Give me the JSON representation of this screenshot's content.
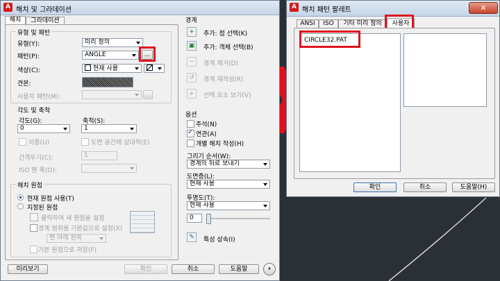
{
  "colors": {
    "highlight": "#e0121f",
    "canvas": "#2b3036",
    "dialog": "#f0f0f0",
    "accent": "#1b3b7a"
  },
  "left": {
    "title": "해치 및 그라데이션",
    "tabs": [
      "해치",
      "그라데이션"
    ],
    "type_pattern": {
      "group": "유형 및 패턴",
      "type_label": "유형(Y):",
      "type_value": "미리 정의",
      "pattern_label": "패턴(P):",
      "pattern_value": "ANGLE",
      "browse_label": "...",
      "color_label": "색상(C):",
      "color_value": "현재 사용",
      "color_icon": "no-fill-icon",
      "swatch_label": "견본:",
      "custom_label": "사용자 패턴(M):",
      "custom_browse": "..."
    },
    "angle_scale": {
      "group": "각도 및 축척",
      "angle_label": "각도(G):",
      "angle_value": "0",
      "scale_label": "축척(S):",
      "scale_value": "1",
      "double_label": "이중(U)",
      "paper_label": "도면 공간에 상대적(E)",
      "spacing_label": "간격두기(C):",
      "spacing_value": "1",
      "iso_label": "ISO 펜 폭(O):"
    },
    "origin": {
      "group": "해치 원점",
      "current_label": "현재 원점 사용(T)",
      "specified_label": "지정된 원점",
      "click_label": "클릭하여 새 원점을 설정",
      "default_extents_label": "경계 범위를 기본값으로 설정(X)",
      "corner_value": "맨 아래 왼쪽",
      "store_label": "기본 원점으로 저장(F)"
    },
    "boundaries": {
      "group": "경계",
      "items": [
        {
          "label": "추가: 점 선택(K)",
          "icon": "pick-points-icon",
          "enabled": true
        },
        {
          "label": "추가: 객체 선택(B)",
          "icon": "select-objects-icon",
          "enabled": true
        },
        {
          "label": "경계 제거(D)",
          "icon": "remove-boundaries-icon",
          "enabled": false
        },
        {
          "label": "경계 재작성(R)",
          "icon": "recreate-boundary-icon",
          "enabled": false
        },
        {
          "label": "선택 요소 보기(V)",
          "icon": "view-selections-icon",
          "enabled": false
        }
      ]
    },
    "options": {
      "group": "옵션",
      "annotative_label": "주석(N)",
      "associative_label": "연관(A)",
      "separate_label": "개별 해치 작성(H)",
      "draw_order_label": "그리기 순서(W):",
      "draw_order_value": "경계의 뒤로 보내기",
      "layer_label": "도면층(L):",
      "layer_value": "현재 사용",
      "transparency_label": "투명도(T):",
      "transparency_value": "현재 사용",
      "slider_value": "0"
    },
    "inherit_label": "특성 상속(I)",
    "footer": {
      "preview": "미리보기",
      "ok": "확인",
      "cancel": "취소",
      "help": "도움말",
      "more": "›"
    }
  },
  "right": {
    "title": "해치 패턴 팔레트",
    "tabs": [
      "ANSI",
      "ISO",
      "기타 미리 정의",
      "사용자"
    ],
    "list_items": [
      "CIRCLE32.PAT"
    ],
    "footer": {
      "ok": "확인",
      "cancel": "취소",
      "help": "도움말(H)"
    }
  }
}
